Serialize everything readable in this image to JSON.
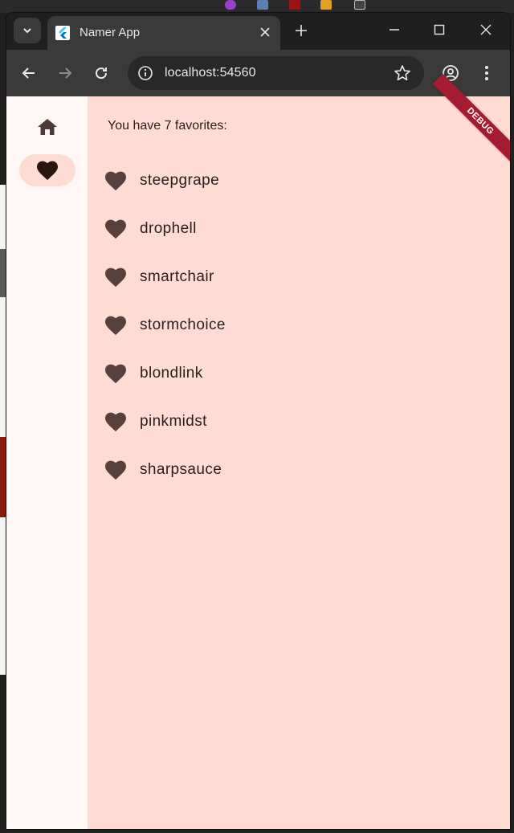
{
  "browser": {
    "tab_title": "Namer App",
    "url": "localhost:54560"
  },
  "rail": {
    "items": [
      {
        "icon": "home-icon",
        "selected": false
      },
      {
        "icon": "heart-icon",
        "selected": true
      }
    ]
  },
  "favorites": {
    "header": "You have 7 favorites:",
    "items": [
      "steepgrape",
      "drophell",
      "smartchair",
      "stormchoice",
      "blondlink",
      "pinkmidst",
      "sharpsauce"
    ]
  },
  "debug_banner": "DEBUG",
  "colors": {
    "background": "#ffdcd3",
    "rail": "#fff7f5",
    "text": "#2c1d1a",
    "icon": "#5a403c",
    "debug": "#a51c30"
  }
}
